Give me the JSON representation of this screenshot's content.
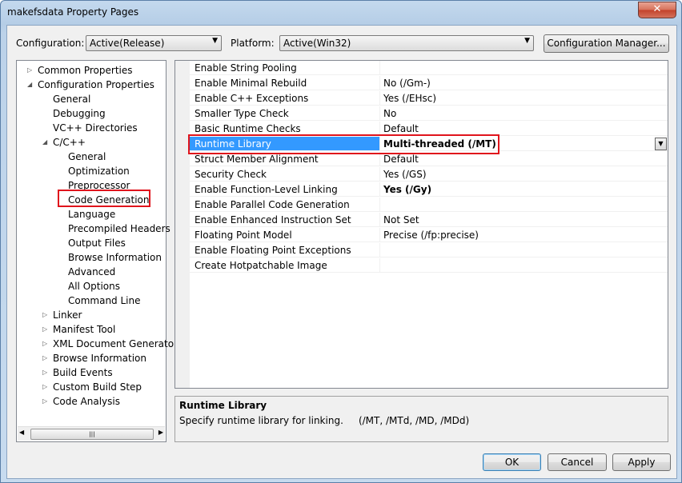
{
  "window": {
    "title": "makefsdata Property Pages",
    "close_glyph": "✕"
  },
  "config_bar": {
    "configuration_label": "Configuration:",
    "configuration_value": "Active(Release)",
    "platform_label": "Platform:",
    "platform_value": "Active(Win32)",
    "config_manager_label": "Configuration Manager..."
  },
  "tree": {
    "nodes": [
      {
        "label": "Common Properties",
        "expander": "▷"
      },
      {
        "label": "Configuration Properties",
        "expander": "◢"
      },
      {
        "label": "General",
        "expander": ""
      },
      {
        "label": "Debugging",
        "expander": ""
      },
      {
        "label": "VC++ Directories",
        "expander": ""
      },
      {
        "label": "C/C++",
        "expander": "◢"
      },
      {
        "label": "General",
        "expander": ""
      },
      {
        "label": "Optimization",
        "expander": ""
      },
      {
        "label": "Preprocessor",
        "expander": ""
      },
      {
        "label": "Code Generation",
        "expander": ""
      },
      {
        "label": "Language",
        "expander": ""
      },
      {
        "label": "Precompiled Headers",
        "expander": ""
      },
      {
        "label": "Output Files",
        "expander": ""
      },
      {
        "label": "Browse Information",
        "expander": ""
      },
      {
        "label": "Advanced",
        "expander": ""
      },
      {
        "label": "All Options",
        "expander": ""
      },
      {
        "label": "Command Line",
        "expander": ""
      },
      {
        "label": "Linker",
        "expander": "▷"
      },
      {
        "label": "Manifest Tool",
        "expander": "▷"
      },
      {
        "label": "XML Document Generator",
        "expander": "▷"
      },
      {
        "label": "Browse Information",
        "expander": "▷"
      },
      {
        "label": "Build Events",
        "expander": "▷"
      },
      {
        "label": "Custom Build Step",
        "expander": "▷"
      },
      {
        "label": "Code Analysis",
        "expander": "▷"
      }
    ],
    "scroll_grip": "|||"
  },
  "properties": [
    {
      "name": "Enable String Pooling",
      "value": ""
    },
    {
      "name": "Enable Minimal Rebuild",
      "value": "No (/Gm-)"
    },
    {
      "name": "Enable C++ Exceptions",
      "value": "Yes (/EHsc)"
    },
    {
      "name": "Smaller Type Check",
      "value": "No"
    },
    {
      "name": "Basic Runtime Checks",
      "value": "Default"
    },
    {
      "name": "Runtime Library",
      "value": "Multi-threaded (/MT)"
    },
    {
      "name": "Struct Member Alignment",
      "value": "Default"
    },
    {
      "name": "Security Check",
      "value": "Yes (/GS)"
    },
    {
      "name": "Enable Function-Level Linking",
      "value": "Yes (/Gy)"
    },
    {
      "name": "Enable Parallel Code Generation",
      "value": ""
    },
    {
      "name": "Enable Enhanced Instruction Set",
      "value": "Not Set"
    },
    {
      "name": "Floating Point Model",
      "value": "Precise (/fp:precise)"
    },
    {
      "name": "Enable Floating Point Exceptions",
      "value": ""
    },
    {
      "name": "Create Hotpatchable Image",
      "value": ""
    }
  ],
  "description": {
    "title": "Runtime Library",
    "text": "Specify runtime library for linking.     (/MT, /MTd, /MD, /MDd)"
  },
  "buttons": {
    "ok": "OK",
    "cancel": "Cancel",
    "apply": "Apply"
  },
  "colors": {
    "selection": "#3399ff",
    "highlight_box": "#e0141c"
  }
}
